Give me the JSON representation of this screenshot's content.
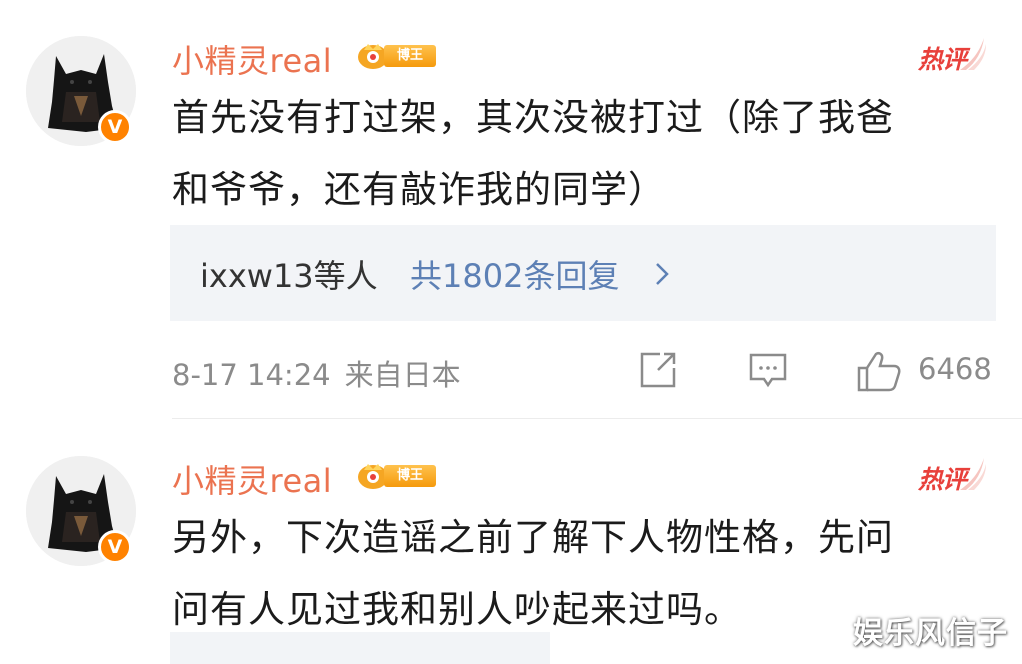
{
  "comments": [
    {
      "username": "小精灵real",
      "level_badge": "博王",
      "verified_badge": "V",
      "hot_label": "热评",
      "lines": [
        "首先没有打过架，其次没被打过（除了我爸",
        "和爷爷，还有敲诈我的同学）"
      ],
      "replies": {
        "names": "ixxw13等人",
        "count": "共1802条回复"
      },
      "time": "8-17 14:24",
      "source": "来自日本",
      "likes": "6468"
    },
    {
      "username": "小精灵real",
      "level_badge": "博王",
      "verified_badge": "V",
      "hot_label": "热评",
      "lines": [
        "另外，下次造谣之前了解下人物性格，先问",
        "问有人见过我和别人吵起来过吗。"
      ]
    }
  ],
  "watermark": "娱乐风信子",
  "colors": {
    "username": "#eb7350",
    "link": "#5d80b5",
    "hot": "#e8403b",
    "verified": "#ff8200"
  },
  "icons": [
    "repost-icon",
    "comment-icon",
    "thumbs-up-icon",
    "chevron-right-icon"
  ]
}
